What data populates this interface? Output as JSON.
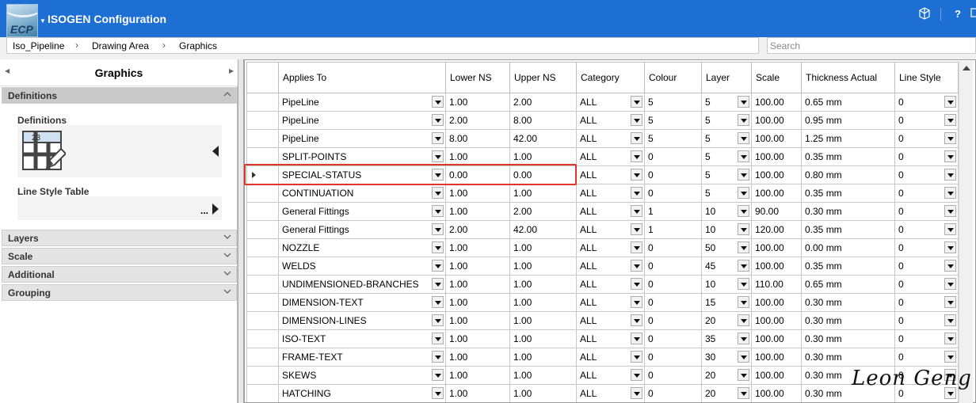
{
  "app": {
    "logo_text": "ECP",
    "title": "ISOGEN Configuration",
    "icons": [
      "cube-icon",
      "help-icon",
      "window-icon"
    ],
    "help_label": "?"
  },
  "breadcrumb": [
    "Iso_Pipeline",
    "Drawing Area",
    "Graphics"
  ],
  "search": {
    "placeholder": "Search",
    "value": ""
  },
  "left_panel": {
    "title": "Graphics",
    "sections": [
      {
        "label": "Definitions",
        "expanded": true
      },
      {
        "label": "Layers",
        "expanded": false
      },
      {
        "label": "Scale",
        "expanded": false
      },
      {
        "label": "Additional",
        "expanded": false
      },
      {
        "label": "Grouping",
        "expanded": false
      }
    ],
    "definitions_label": "Definitions",
    "definitions_icon_number": "23",
    "line_style_label": "Line Style Table",
    "ellipsis": "..."
  },
  "grid": {
    "columns": [
      {
        "label": "Applies To"
      },
      {
        "label": "Lower NS"
      },
      {
        "label": "Upper NS"
      },
      {
        "label": "Category"
      },
      {
        "label": "Colour"
      },
      {
        "label": "Layer"
      },
      {
        "label": "Scale"
      },
      {
        "label": "Thickness Actual"
      },
      {
        "label": "Line Style"
      }
    ],
    "selected_row": 4,
    "rows": [
      [
        "PipeLine",
        "1.00",
        "2.00",
        "ALL",
        "5",
        "5",
        "100.00",
        "0.65 mm",
        "0"
      ],
      [
        "PipeLine",
        "2.00",
        "8.00",
        "ALL",
        "5",
        "5",
        "100.00",
        "0.95 mm",
        "0"
      ],
      [
        "PipeLine",
        "8.00",
        "42.00",
        "ALL",
        "5",
        "5",
        "100.00",
        "1.25 mm",
        "0"
      ],
      [
        "SPLIT-POINTS",
        "1.00",
        "1.00",
        "ALL",
        "0",
        "5",
        "100.00",
        "0.35 mm",
        "0"
      ],
      [
        "SPECIAL-STATUS",
        "0.00",
        "0.00",
        "ALL",
        "0",
        "5",
        "100.00",
        "0.80 mm",
        "0"
      ],
      [
        "CONTINUATION",
        "1.00",
        "1.00",
        "ALL",
        "0",
        "5",
        "100.00",
        "0.35 mm",
        "0"
      ],
      [
        "General Fittings",
        "1.00",
        "2.00",
        "ALL",
        "1",
        "10",
        "90.00",
        "0.30 mm",
        "0"
      ],
      [
        "General Fittings",
        "2.00",
        "42.00",
        "ALL",
        "1",
        "10",
        "120.00",
        "0.35 mm",
        "0"
      ],
      [
        "NOZZLE",
        "1.00",
        "1.00",
        "ALL",
        "0",
        "50",
        "100.00",
        "0.00 mm",
        "0"
      ],
      [
        "WELDS",
        "1.00",
        "1.00",
        "ALL",
        "0",
        "45",
        "100.00",
        "0.35 mm",
        "0"
      ],
      [
        "UNDIMENSIONED-BRANCHES",
        "1.00",
        "1.00",
        "ALL",
        "0",
        "10",
        "110.00",
        "0.65 mm",
        "0"
      ],
      [
        "DIMENSION-TEXT",
        "1.00",
        "1.00",
        "ALL",
        "0",
        "15",
        "100.00",
        "0.30 mm",
        "0"
      ],
      [
        "DIMENSION-LINES",
        "1.00",
        "1.00",
        "ALL",
        "0",
        "20",
        "100.00",
        "0.30 mm",
        "0"
      ],
      [
        "ISO-TEXT",
        "1.00",
        "1.00",
        "ALL",
        "0",
        "35",
        "100.00",
        "0.30 mm",
        "0"
      ],
      [
        "FRAME-TEXT",
        "1.00",
        "1.00",
        "ALL",
        "0",
        "30",
        "100.00",
        "0.30 mm",
        "0"
      ],
      [
        "SKEWS",
        "1.00",
        "1.00",
        "ALL",
        "0",
        "20",
        "100.00",
        "0.30 mm",
        "0"
      ],
      [
        "HATCHING",
        "1.00",
        "1.00",
        "ALL",
        "0",
        "20",
        "100.00",
        "0.30 mm",
        "0"
      ]
    ]
  },
  "watermark": "Leon Geng",
  "colors": {
    "titlebar": "#1e6fd3",
    "highlight": "#e0332b",
    "section_active": "#c9c9c9"
  }
}
